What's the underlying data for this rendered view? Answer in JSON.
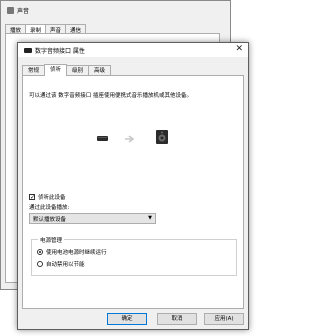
{
  "background_window": {
    "title": "声音",
    "tabs": [
      {
        "label": "播放",
        "active": false
      },
      {
        "label": "录制",
        "active": true
      },
      {
        "label": "声音",
        "active": false
      },
      {
        "label": "通信",
        "active": false
      }
    ]
  },
  "dialog": {
    "title": "数字音频接口 属性",
    "close_icon": "close-icon",
    "tabs": [
      {
        "label": "常规",
        "active": false
      },
      {
        "label": "侦听",
        "active": true
      },
      {
        "label": "级别",
        "active": false
      },
      {
        "label": "高级",
        "active": false
      }
    ],
    "description": "可以通过该 数字音频接口 插座使用便携式音乐播放机或其他设备。",
    "listen_checkbox": {
      "label": "侦听此设备",
      "checked": true
    },
    "playback_via_label": "通过此设备播放:",
    "playback_device": "默认播放设备",
    "power": {
      "group_title": "电源管理",
      "options": [
        {
          "label": "使用电池电源时继续运行",
          "selected": true
        },
        {
          "label": "自动禁用以节能",
          "selected": false
        }
      ]
    },
    "buttons": {
      "ok": "确定",
      "cancel": "取消",
      "apply": "应用(A)"
    }
  }
}
